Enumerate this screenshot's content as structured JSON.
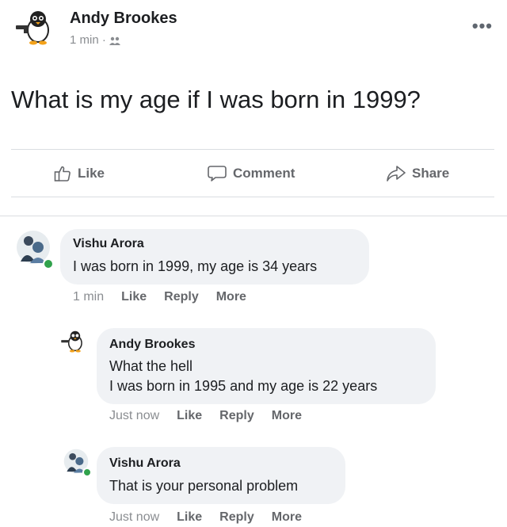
{
  "post": {
    "author": "Andy Brookes",
    "time": "1 min",
    "audience_sep": "·",
    "audience_icon": "friends-icon",
    "menu": "•••",
    "text": "What is my age if I was born in 1999?"
  },
  "actions": {
    "like": "Like",
    "comment": "Comment",
    "share": "Share"
  },
  "comments": [
    {
      "name": "Vishu Arora",
      "lines": [
        "I was born in 1999, my age is 34 years"
      ],
      "time": "1 min",
      "like": "Like",
      "reply": "Reply",
      "more": "More"
    },
    {
      "name": "Andy Brookes",
      "lines": [
        "What the hell",
        "I was born in 1995 and my age is 22 years"
      ],
      "time": "Just now",
      "like": "Like",
      "reply": "Reply",
      "more": "More"
    },
    {
      "name": "Vishu Arora",
      "lines": [
        "That is your personal problem"
      ],
      "time": "Just now",
      "like": "Like",
      "reply": "Reply",
      "more": "More"
    }
  ],
  "colors": {
    "bubble": "#f0f2f5",
    "secondary_text": "#65676b",
    "online": "#31a24c"
  }
}
